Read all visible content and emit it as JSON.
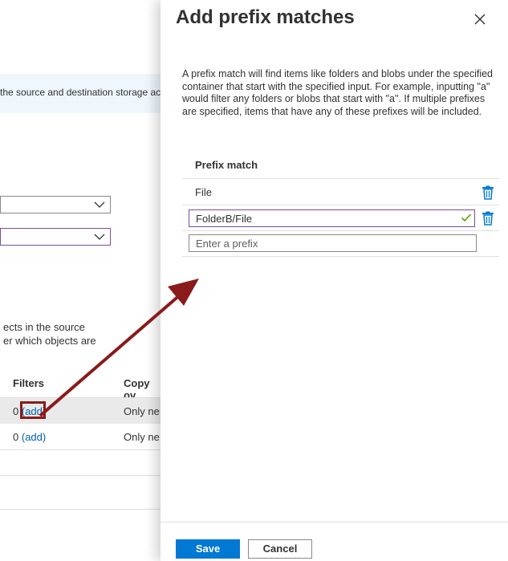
{
  "background": {
    "info_text": "the source and destination storage acc",
    "description_lines": [
      "ects in the source",
      "er which objects are"
    ],
    "table": {
      "headers": [
        "Filters",
        "Copy ov"
      ],
      "rows": [
        {
          "count": "0",
          "add_label": "(add)",
          "copy": "Only ne"
        },
        {
          "count": "0",
          "add_label": "(add)",
          "copy": "Only ne"
        }
      ]
    }
  },
  "panel": {
    "title": "Add prefix matches",
    "description": "A prefix match will find items like folders and blobs under the specified container that start with the specified input. For example, inputting \"a\" would filter any folders or blobs that start with \"a\". If multiple prefixes are specified, items that have any of these prefixes will be included.",
    "column_header": "Prefix match",
    "items": [
      {
        "value": "File"
      },
      {
        "value": "FolderB/File"
      }
    ],
    "new_input_placeholder": "Enter a prefix",
    "save_label": "Save",
    "cancel_label": "Cancel"
  },
  "colors": {
    "accent": "#0078d4",
    "link": "#0062ad",
    "annotation": "#8b1a1a",
    "valid_check": "#57a300"
  }
}
